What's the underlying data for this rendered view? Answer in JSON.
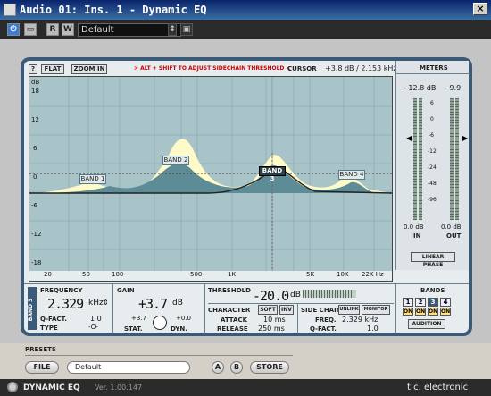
{
  "window": {
    "title": "Audio 01: Ins. 1 - Dynamic EQ",
    "close": "×"
  },
  "toolbar": {
    "r_label": "R",
    "w_label": "W",
    "preset": "Default"
  },
  "header": {
    "flat": "FLAT",
    "zoom_in": "ZOOM IN",
    "hint": "> ALT + SHIFT TO ADJUST SIDECHAIN THRESHOLD <",
    "cursor_label": "CURSOR",
    "cursor_value": "+3.8 dB / 2.153 kHz"
  },
  "graph": {
    "y_unit": "dB",
    "y_ticks": [
      "18",
      "12",
      "6",
      "0",
      "-6",
      "-12",
      "-18"
    ],
    "x_ticks": [
      "20",
      "50",
      "100",
      "500",
      "1K",
      "5K",
      "10K",
      "22K Hz"
    ],
    "bands": [
      "BAND 1",
      "BAND 2",
      "BAND 3",
      "BAND 4"
    ],
    "colors": {
      "bg": "#a9c4c8",
      "envelope": "#fffbc8",
      "fill": "#5d8b96",
      "line": "#222"
    }
  },
  "meters": {
    "title": "METERS",
    "in_peak": "- 12.8 dB",
    "out_peak": "- 9.9",
    "scale": [
      "6",
      "0",
      "-6",
      "-12",
      "-24",
      "-48",
      "-96"
    ],
    "in_val": "0.0 dB",
    "out_val": "0.0 dB",
    "in_label": "IN",
    "out_label": "OUT",
    "linear_phase": "LINEAR PHASE"
  },
  "band_panel": {
    "side_label": "BAND 3",
    "frequency_label": "FREQUENCY",
    "frequency_value": "2.329",
    "frequency_unit": "kHz",
    "qfact_label": "Q-FACT.",
    "qfact_value": "1.0",
    "type_label": "TYPE",
    "type_value": "-O-",
    "gain_label": "GAIN",
    "gain_value": "+3.7",
    "gain_unit": "dB",
    "gain_min": "+3.7",
    "gain_max": "+0.0",
    "stat_label": "STAT.",
    "dyn_label": "DYN.",
    "threshold_label": "THRESHOLD",
    "threshold_value": "-20.0",
    "threshold_unit": "dB",
    "character_label": "CHARACTER",
    "soft_label": "SOFT",
    "inv_label": "INV",
    "attack_label": "ATTACK",
    "attack_value": "10 ms",
    "release_label": "RELEASE",
    "release_value": "250 ms",
    "sidechain_label": "SIDE CHAIN",
    "unlink_label": "UNLINK",
    "monitor_label": "MONITOR",
    "sc_freq_label": "FREQ.",
    "sc_freq_value": "2.329 kHz",
    "sc_q_label": "Q-FACT.",
    "sc_q_value": "1.0"
  },
  "bands_panel": {
    "title": "BANDS",
    "numbers": [
      "1",
      "2",
      "3",
      "4"
    ],
    "on": [
      "ON",
      "ON",
      "ON",
      "ON"
    ],
    "audition": "AUDITION"
  },
  "presets": {
    "title": "PRESETS",
    "file": "FILE",
    "name": "Default",
    "a": "A",
    "b": "B",
    "store": "STORE"
  },
  "footer": {
    "product": "DYNAMIC EQ",
    "version": "Ver. 1.00.147",
    "brand": "t.c. electronic"
  }
}
